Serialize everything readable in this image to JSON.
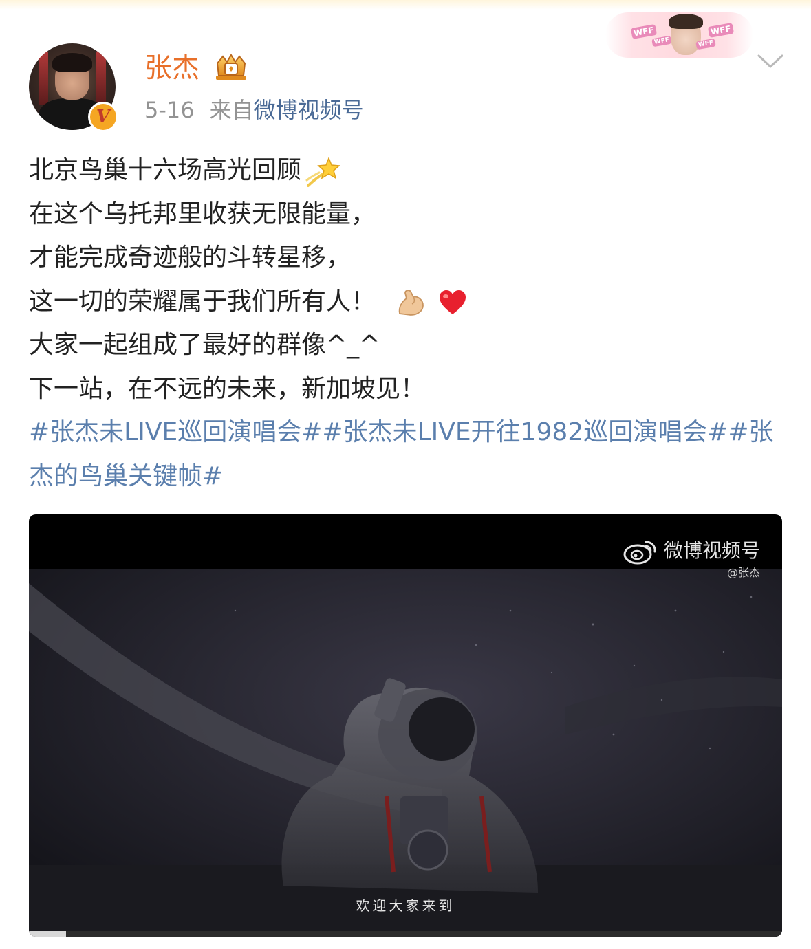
{
  "user": {
    "name": "张杰",
    "avatar_icon": "avatar-photo",
    "badge_icon": "verified-v-icon",
    "badge_letter": "V",
    "crown_icon": "crown-membership-icon"
  },
  "meta": {
    "date": "5-16",
    "source_prefix": "来自",
    "source_name": "微博视频号"
  },
  "banner": {
    "tag": "WFF",
    "icon": "decorative-banner"
  },
  "post": {
    "lines": [
      "北京鸟巢十六场高光回顾",
      "在这个乌托邦里收获无限能量，",
      "才能完成奇迹般的斗转星移，",
      "这一切的荣耀属于我们所有人！",
      "大家一起组成了最好的群像^_^",
      "下一站，在不远的未来，新加坡见！"
    ],
    "line_emojis": {
      "0": "dizzy-star-emoji",
      "3": "flexed-biceps-emoji, red-heart-emoji"
    },
    "hashtags": "#张杰未LIVE巡回演唱会##张杰未LIVE开往1982巡回演唱会##张杰的鸟巢关键帧#"
  },
  "video": {
    "watermark_brand": "微博视频号",
    "watermark_handle": "@张杰",
    "subtitle": "欢迎大家来到",
    "progress_fraction": 0.049
  },
  "colors": {
    "username": "#e8702a",
    "link": "#5b7fad",
    "meta": "#939393",
    "text": "#222222"
  }
}
